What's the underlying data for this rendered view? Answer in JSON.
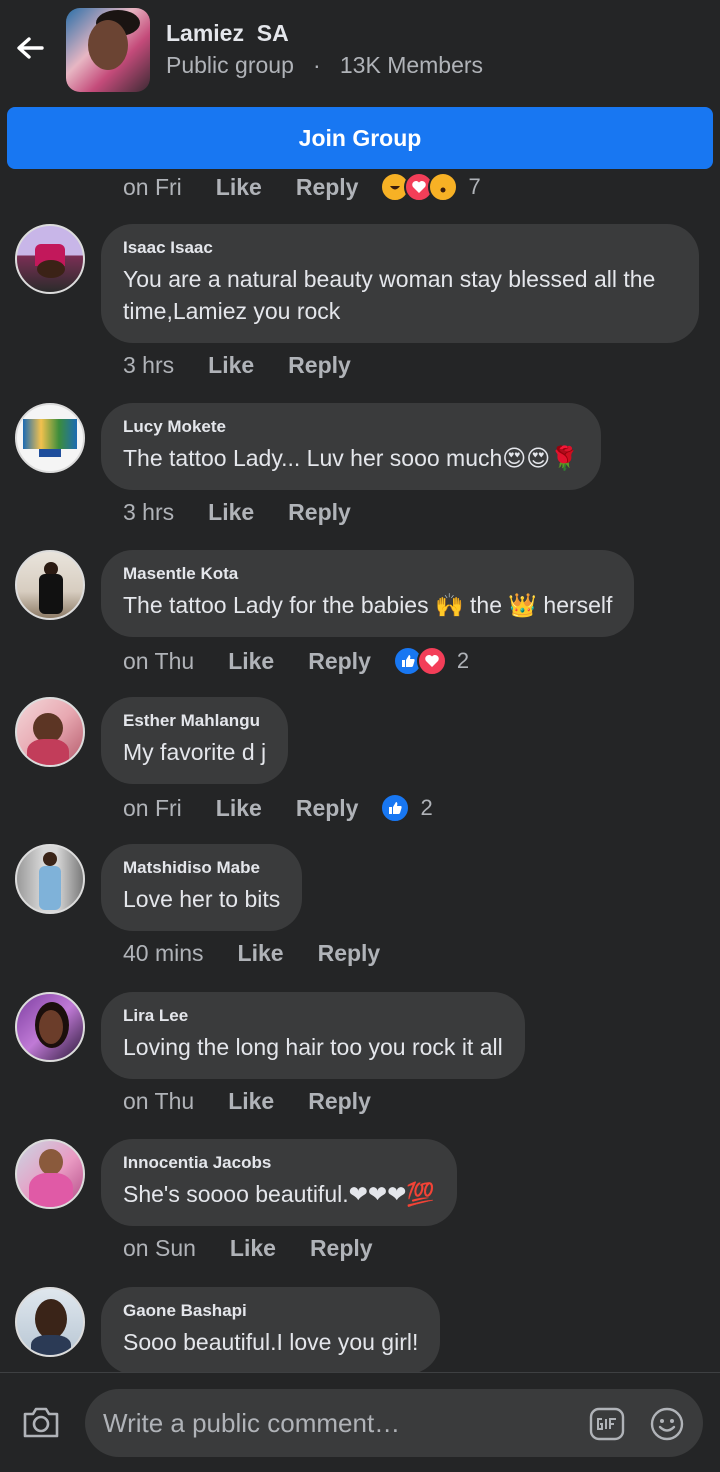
{
  "header": {
    "back_icon": "arrow-left-icon",
    "group_name": "Lamiez  SA",
    "group_privacy": "Public group",
    "separator": "·",
    "member_count": "13K Members"
  },
  "join_button": "Join Group",
  "partial_row": {
    "time": "on Fri",
    "like": "Like",
    "reply": "Reply",
    "count": "7"
  },
  "comments": [
    {
      "author": "Isaac Isaac",
      "text": "You are a natural beauty woman stay blessed all the time,Lamiez you rock",
      "time": "3 hrs",
      "like": "Like",
      "reply": "Reply"
    },
    {
      "author": "Lucy Mokete",
      "text": "The tattoo Lady... Luv her sooo much😍😍🌹",
      "time": "3 hrs",
      "like": "Like",
      "reply": "Reply"
    },
    {
      "author": "Masentle Kota",
      "text": "The tattoo Lady for the babies 🙌 the 👑 herself",
      "time": "on Thu",
      "like": "Like",
      "reply": "Reply",
      "reaction_count": "2"
    },
    {
      "author": "Esther Mahlangu",
      "text": "My favorite d j",
      "time": "on Fri",
      "like": "Like",
      "reply": "Reply",
      "reaction_count": "2"
    },
    {
      "author": "Matshidiso Mabe",
      "text": "Love her to bits",
      "time": "40 mins",
      "like": "Like",
      "reply": "Reply"
    },
    {
      "author": "Lira Lee",
      "text": "Loving the long hair too you rock it all",
      "time": "on Thu",
      "like": "Like",
      "reply": "Reply"
    },
    {
      "author": "Innocentia Jacobs",
      "text": "She's soooo beautiful.❤❤❤💯",
      "time": "on Sun",
      "like": "Like",
      "reply": "Reply"
    },
    {
      "author": "Gaone Bashapi",
      "text": "Sooo beautiful.I love you girl!"
    }
  ],
  "composer": {
    "placeholder": "Write a public comment…",
    "camera_icon": "camera-icon",
    "gif_icon": "gif-icon",
    "emoji_icon": "emoji-smile-icon"
  },
  "colors": {
    "background": "#242526",
    "bubble": "#3a3b3c",
    "accent": "#1877f2",
    "text": "#e4e6eb",
    "secondary_text": "#b0b3b8"
  }
}
